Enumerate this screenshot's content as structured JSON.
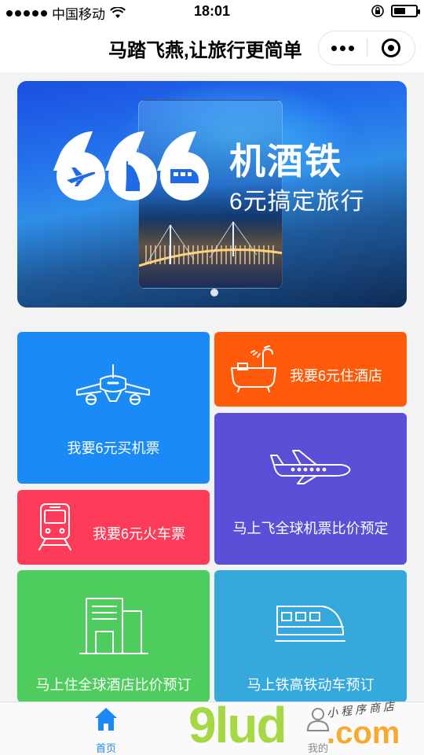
{
  "status_bar": {
    "carrier": "中国移动",
    "time": "18:01"
  },
  "nav": {
    "title": "马踏飞燕,让旅行更简单"
  },
  "banner": {
    "number": "666",
    "title": "机酒铁",
    "subtitle": "6元搞定旅行"
  },
  "tiles": {
    "flight_6": "我要6元买机票",
    "hotel_6": "我要6元住酒店",
    "global_flight": "马上飞全球机票比价预定",
    "train_6": "我要6元火车票",
    "global_hotel": "马上住全球酒店比价预订",
    "rail": "马上铁高铁动车预订"
  },
  "tab_bar": {
    "home": "首页",
    "mine": "我的"
  },
  "watermark": {
    "main": "9lud",
    "com": ".com",
    "cn": "小程序商店"
  },
  "colors": {
    "flight_tile": "#1a8af7",
    "hotel_tile": "#ff5a0a",
    "global_flight_tile": "#5a4fd6",
    "train_tile": "#ff3b5a",
    "global_hotel_tile": "#4ecc5e",
    "rail_tile": "#35a9dc",
    "tab_active": "#1a8af7"
  }
}
